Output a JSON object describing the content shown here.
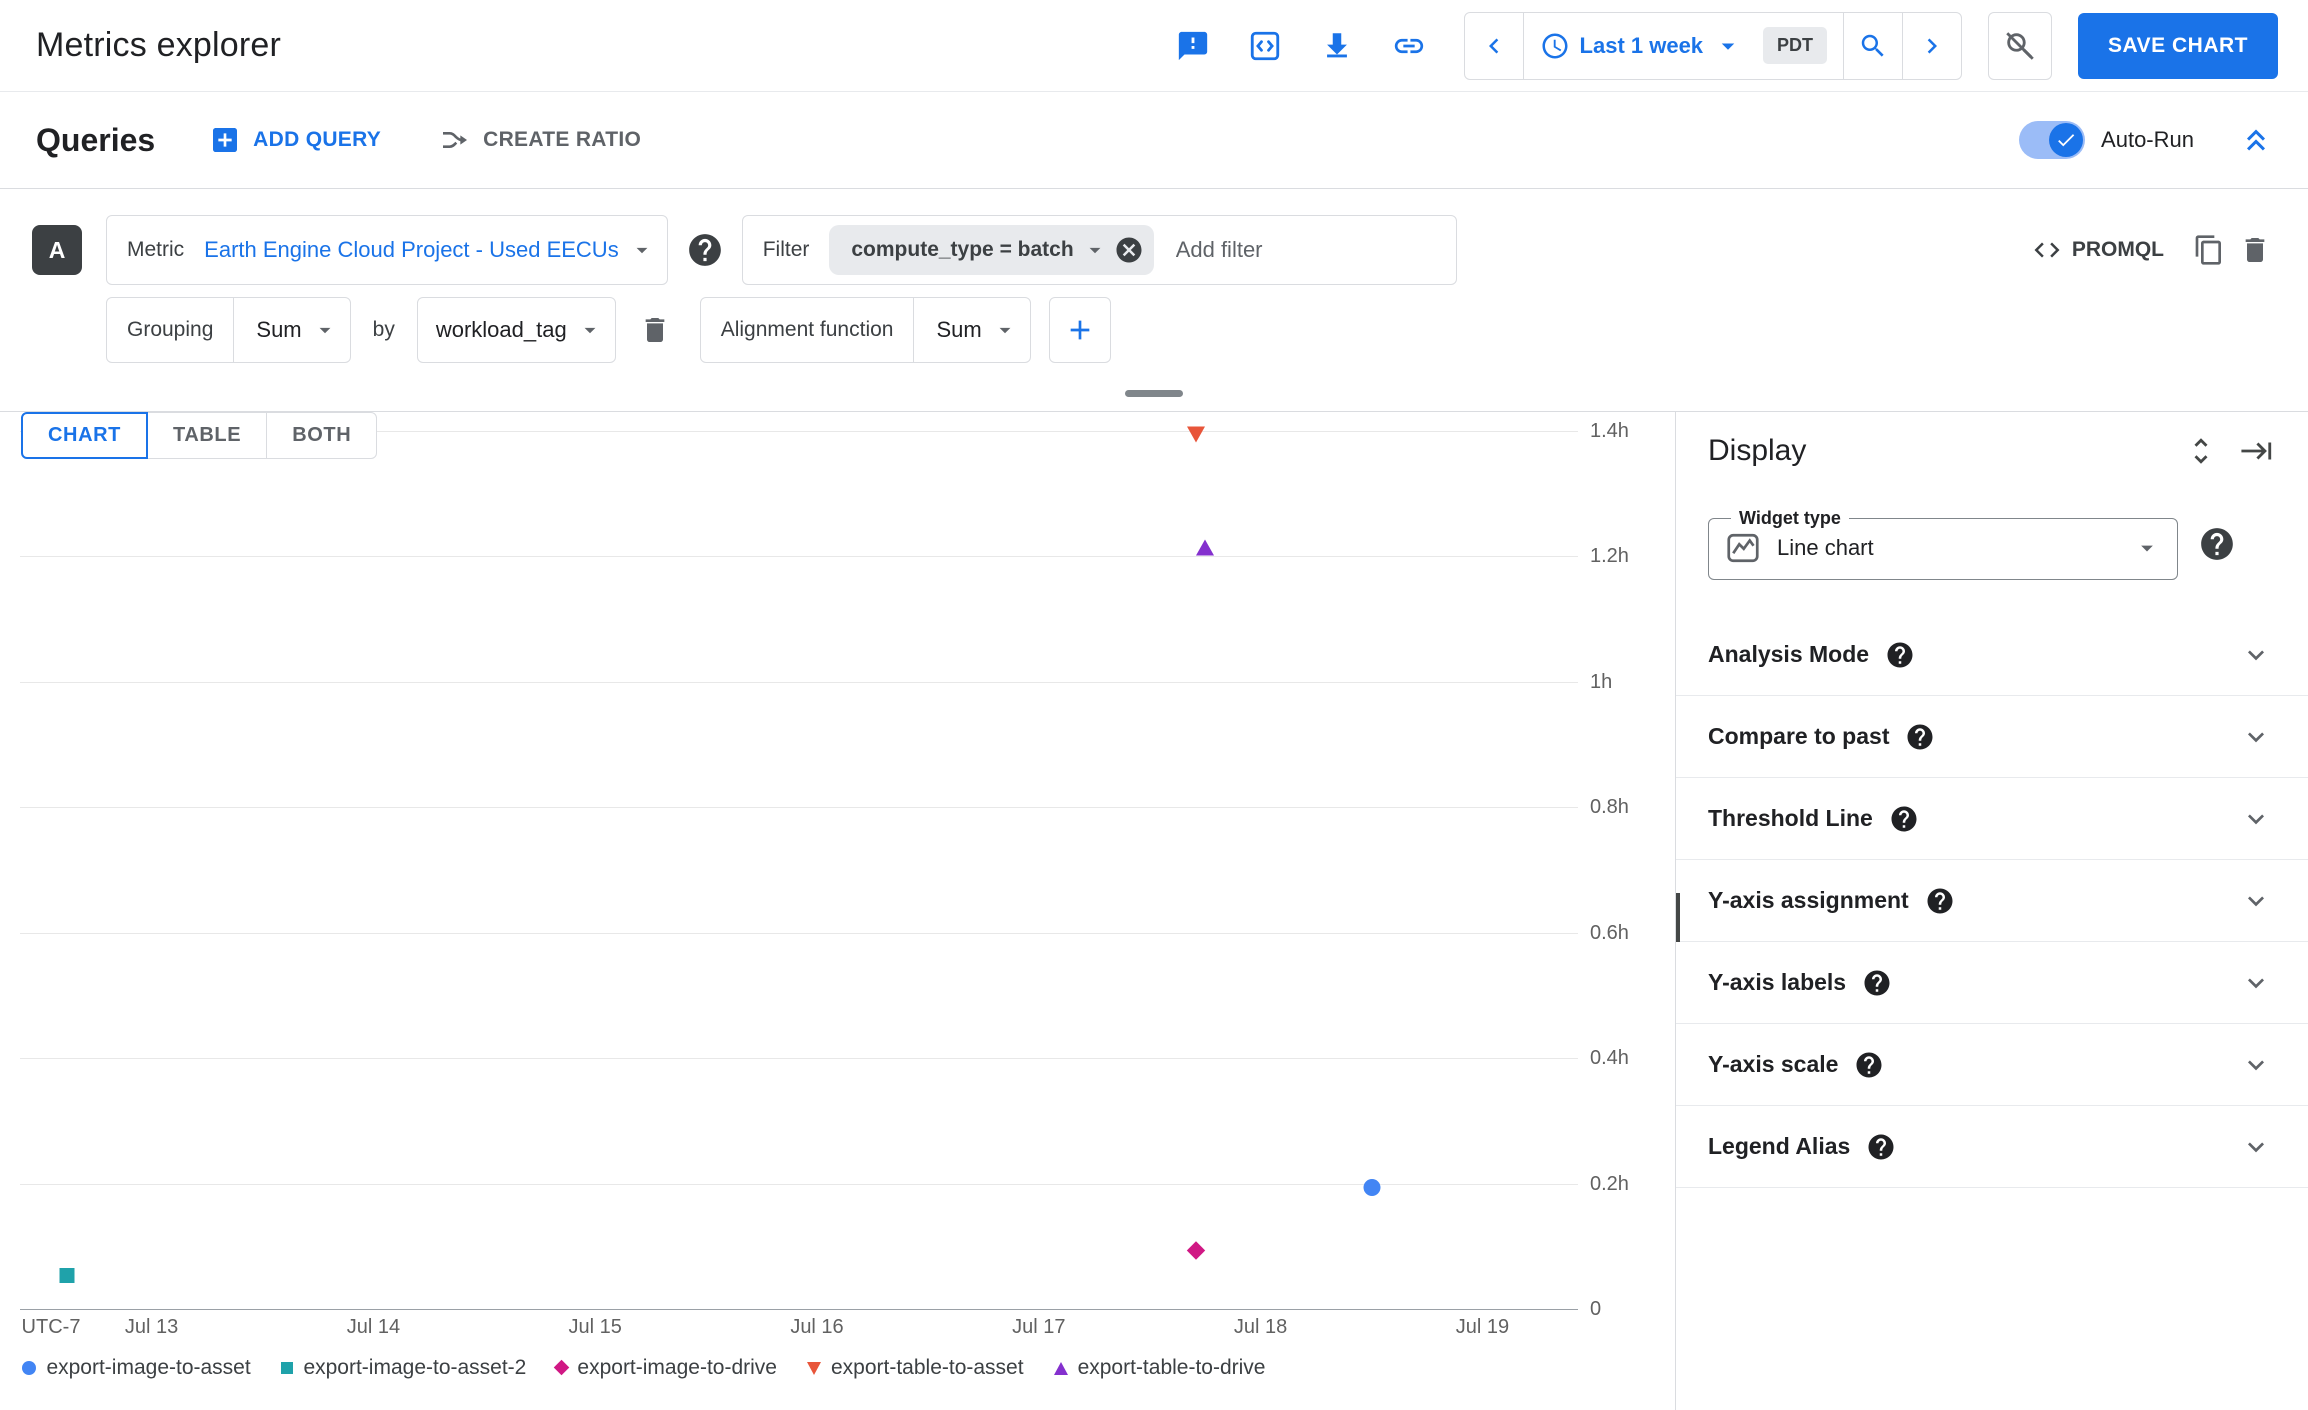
{
  "header": {
    "title": "Metrics explorer",
    "time_range_label": "Last 1 week",
    "timezone_chip": "PDT",
    "save_button_label": "SAVE CHART"
  },
  "queries_bar": {
    "title": "Queries",
    "add_query_label": "ADD QUERY",
    "create_ratio_label": "CREATE RATIO",
    "auto_run_label": "Auto-Run"
  },
  "query": {
    "badge": "A",
    "metric": {
      "label": "Metric",
      "value": "Earth Engine Cloud Project - Used EECUs"
    },
    "filter": {
      "label": "Filter",
      "chip": "compute_type = batch",
      "placeholder": "Add filter"
    },
    "promql_label": "PROMQL",
    "grouping": {
      "label": "Grouping",
      "value": "Sum",
      "by_label": "by",
      "by_value": "workload_tag"
    },
    "alignment": {
      "label": "Alignment function",
      "value": "Sum"
    }
  },
  "view_tabs": [
    {
      "label": "CHART",
      "active": true
    },
    {
      "label": "TABLE",
      "active": false
    },
    {
      "label": "BOTH",
      "active": false
    }
  ],
  "chart_data": {
    "type": "scatter",
    "x_axis": {
      "prefix_label": "UTC-7",
      "tick_days": [
        13,
        14,
        15,
        16,
        17,
        18,
        19
      ],
      "tick_labels": [
        "Jul 13",
        "Jul 14",
        "Jul 15",
        "Jul 16",
        "Jul 17",
        "Jul 18",
        "Jul 19"
      ]
    },
    "y_axis": {
      "unit": "hours",
      "min": 0,
      "max": 1.4,
      "tick_labels": [
        "0",
        "0.2h",
        "0.4h",
        "0.6h",
        "0.8h",
        "1h",
        "1.2h",
        "1.4h"
      ]
    },
    "series": [
      {
        "name": "export-image-to-asset",
        "marker": "circle",
        "color": "#4285f4",
        "points": [
          {
            "day": 18.5,
            "hours": 0.19
          }
        ]
      },
      {
        "name": "export-image-to-asset-2",
        "marker": "square",
        "color": "#1fa2aa",
        "points": [
          {
            "day": 12.62,
            "hours": 0.05
          }
        ]
      },
      {
        "name": "export-image-to-drive",
        "marker": "diamond",
        "color": "#d01884",
        "points": [
          {
            "day": 17.71,
            "hours": 0.09
          }
        ]
      },
      {
        "name": "export-table-to-asset",
        "marker": "triangle-down",
        "color": "#e8553a",
        "points": [
          {
            "day": 17.71,
            "hours": 1.39
          }
        ]
      },
      {
        "name": "export-table-to-drive",
        "marker": "triangle-up",
        "color": "#8430ce",
        "points": [
          {
            "day": 17.75,
            "hours": 1.21
          }
        ]
      }
    ],
    "grid": true,
    "legend_position": "bottom"
  },
  "display_panel": {
    "title": "Display",
    "widget_type": {
      "label": "Widget type",
      "value": "Line chart"
    },
    "sections": [
      {
        "label": "Analysis Mode"
      },
      {
        "label": "Compare to past"
      },
      {
        "label": "Threshold Line"
      },
      {
        "label": "Y-axis assignment"
      },
      {
        "label": "Y-axis labels"
      },
      {
        "label": "Y-axis scale"
      },
      {
        "label": "Legend Alias"
      }
    ]
  },
  "icons": [
    "feedback",
    "code",
    "download",
    "link",
    "chevron-left",
    "clock",
    "caret-down",
    "search",
    "chevron-right",
    "search-off",
    "add-box",
    "ratio",
    "check",
    "double-chevron-up",
    "help",
    "cancel",
    "copy",
    "delete",
    "plus",
    "unfold-more",
    "skip-right",
    "line-chart",
    "chevron-down"
  ],
  "colors": {
    "accent": "#1a73e8",
    "badge": "#3c4043",
    "chip_bg": "#e8eaed"
  }
}
